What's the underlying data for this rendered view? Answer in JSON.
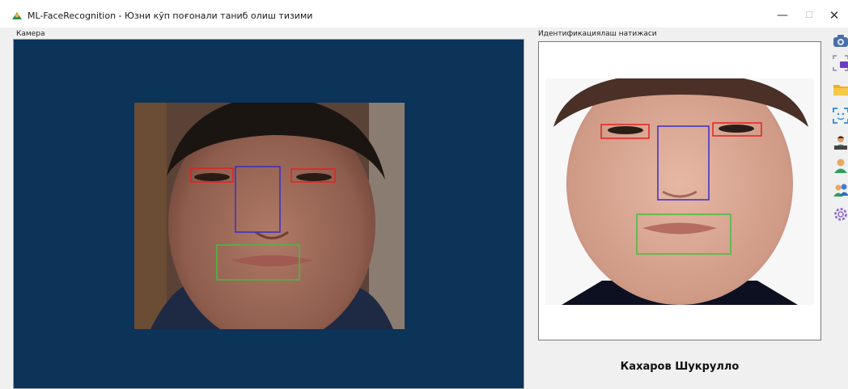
{
  "window": {
    "title": "ML-FaceRecognition - Юзни кўп поғонали таниб олиш тизими",
    "min_symbol": "—",
    "max_symbol": "☐",
    "close_symbol": "✕"
  },
  "camera": {
    "label": "Камера"
  },
  "result": {
    "label": "Идентификациялаш натижаси",
    "person_name": "Кахаров Шукрулло"
  },
  "toolbar": {
    "items": [
      {
        "icon": "camera-icon"
      },
      {
        "icon": "capture-frame-icon"
      },
      {
        "icon": "folder-icon"
      },
      {
        "icon": "face-scan-icon"
      },
      {
        "icon": "user-laptop-icon"
      },
      {
        "icon": "user-icon"
      },
      {
        "icon": "users-icon"
      },
      {
        "icon": "settings-icon"
      }
    ]
  },
  "colors": {
    "camera_bg": "#0c3358",
    "eye_box": "#e52020",
    "nose_box": "#3b2dc8",
    "mouth_box": "#3fbf3f"
  }
}
